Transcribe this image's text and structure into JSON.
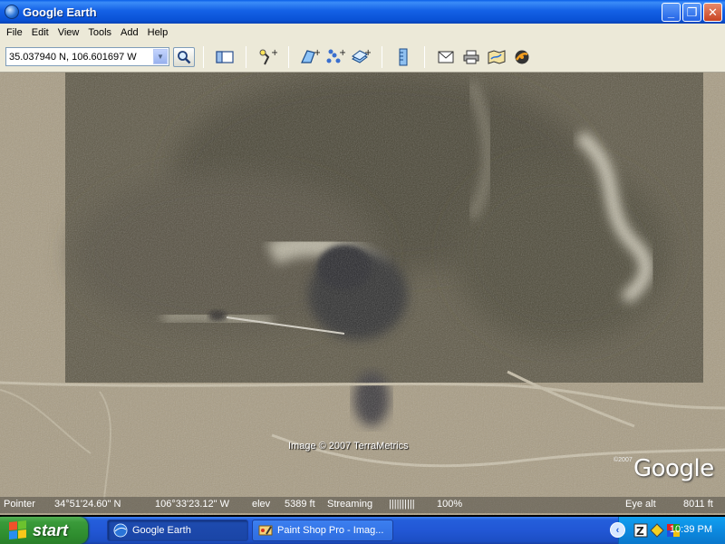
{
  "window": {
    "title": "Google Earth",
    "controls": {
      "minimize": "_",
      "restore": "❐",
      "close": "✕"
    }
  },
  "menu": [
    "File",
    "Edit",
    "View",
    "Tools",
    "Add",
    "Help"
  ],
  "toolbar": {
    "location_value": "35.037940 N, 106.601697 W",
    "icons": [
      "sidebar-icon",
      "placemark-icon",
      "polygon-icon",
      "path-icon",
      "image-overlay-icon",
      "ruler-icon",
      "email-icon",
      "print-icon",
      "maps-icon",
      "sky-icon"
    ]
  },
  "map": {
    "attribution": "Image © 2007 TerraMetrics",
    "logo": "Google",
    "logo_year": "©2007"
  },
  "status": {
    "pointer_label": "Pointer",
    "lat": "34°51'24.60\" N",
    "lon": "106°33'23.12\" W",
    "elev_label": "elev",
    "elev_value": "5389 ft",
    "streaming_label": "Streaming",
    "streaming_bar": "||||||||||",
    "streaming_pct": "100%",
    "eye_label": "Eye alt",
    "eye_value": "8011 ft"
  },
  "taskbar": {
    "start_label": "start",
    "tasks": [
      {
        "label": "Google Earth",
        "active": true
      },
      {
        "label": "Paint Shop Pro - Imag...",
        "active": false
      }
    ],
    "clock": "10:39 PM"
  }
}
